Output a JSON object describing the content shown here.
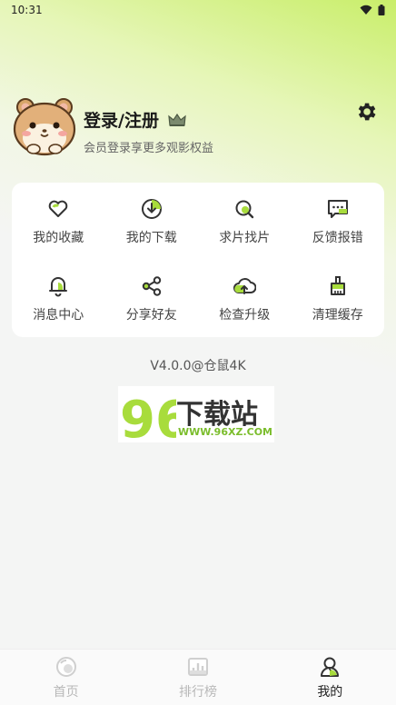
{
  "status_bar": {
    "time": "10:31"
  },
  "profile": {
    "login_label": "登录/注册",
    "subtitle": "会员登录享更多观影权益"
  },
  "menu": [
    {
      "label": "我的收藏",
      "icon": "heart-icon"
    },
    {
      "label": "我的下载",
      "icon": "download-icon"
    },
    {
      "label": "求片找片",
      "icon": "search-icon"
    },
    {
      "label": "反馈报错",
      "icon": "feedback-icon"
    },
    {
      "label": "消息中心",
      "icon": "bell-icon"
    },
    {
      "label": "分享好友",
      "icon": "share-icon"
    },
    {
      "label": "检查升级",
      "icon": "cloud-upload-icon"
    },
    {
      "label": "清理缓存",
      "icon": "broom-icon"
    }
  ],
  "version": "V4.0.0@仓鼠4K",
  "watermark": {
    "brand": "下载站",
    "number": "96",
    "url": "WWW.96XZ.COM"
  },
  "bottom_nav": [
    {
      "label": "首页",
      "icon": "home-icon"
    },
    {
      "label": "排行榜",
      "icon": "ranking-icon"
    },
    {
      "label": "我的",
      "icon": "profile-icon",
      "active": true
    }
  ],
  "colors": {
    "accent": "#a8dc3c",
    "gradient_top": "#c9ee6a"
  }
}
